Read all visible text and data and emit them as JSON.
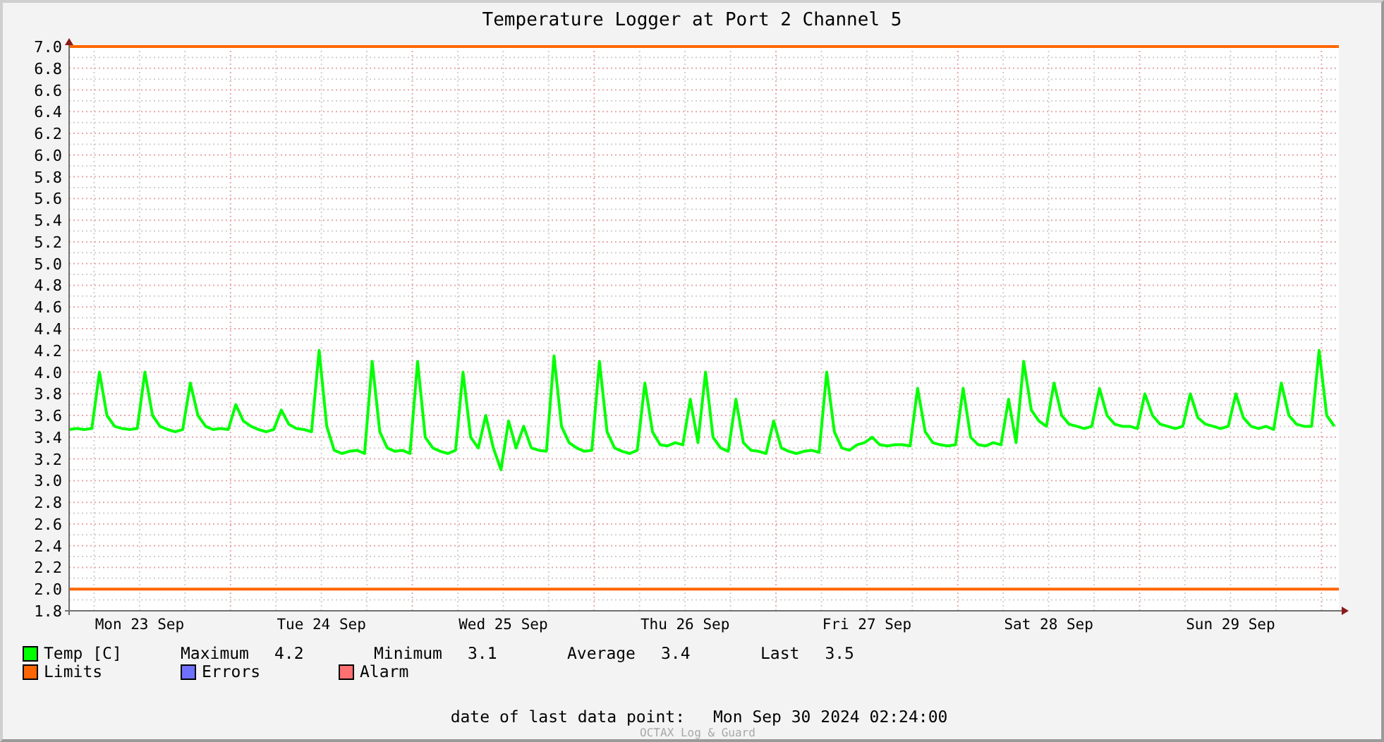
{
  "title": "Temperature Logger at Port 2 Channel 5",
  "chart_data": {
    "type": "line",
    "ylim": [
      1.8,
      7.0
    ],
    "categories": [
      null,
      null,
      null,
      null,
      null,
      null,
      null,
      null,
      null,
      "Mon 23 Sep",
      null,
      null,
      null,
      null,
      null,
      null,
      null,
      null,
      null,
      null,
      null,
      null,
      null,
      null,
      null,
      null,
      null,
      null,
      null,
      null,
      null,
      null,
      null,
      "Tue 24 Sep",
      null,
      null,
      null,
      null,
      null,
      null,
      null,
      null,
      null,
      null,
      null,
      null,
      null,
      null,
      null,
      null,
      null,
      null,
      null,
      null,
      null,
      null,
      null,
      "Wed 25 Sep",
      null,
      null,
      null,
      null,
      null,
      null,
      null,
      null,
      null,
      null,
      null,
      null,
      null,
      null,
      null,
      null,
      null,
      null,
      null,
      null,
      null,
      null,
      null,
      "Thu 26 Sep",
      null,
      null,
      null,
      null,
      null,
      null,
      null,
      null,
      null,
      null,
      null,
      null,
      null,
      null,
      null,
      null,
      null,
      null,
      null,
      null,
      null,
      null,
      null,
      "Fri 27 Sep",
      null,
      null,
      null,
      null,
      null,
      null,
      null,
      null,
      null,
      null,
      null,
      null,
      null,
      null,
      null,
      null,
      null,
      null,
      null,
      null,
      null,
      null,
      null,
      "Sat 28 Sep",
      null,
      null,
      null,
      null,
      null,
      null,
      null,
      null,
      null,
      null,
      null,
      null,
      null,
      null,
      null,
      null,
      null,
      null,
      null,
      null,
      null,
      null,
      null,
      "Sun 29 Sep",
      null,
      null,
      null,
      null,
      null,
      null,
      null,
      null,
      null,
      null,
      null,
      null,
      null,
      null
    ],
    "series": [
      {
        "name": "Temp [C]",
        "color": "#00ff00",
        "values": [
          3.47,
          3.48,
          3.47,
          3.48,
          4.0,
          3.6,
          3.5,
          3.48,
          3.47,
          3.48,
          4.0,
          3.6,
          3.5,
          3.47,
          3.45,
          3.47,
          3.9,
          3.6,
          3.5,
          3.47,
          3.48,
          3.47,
          3.7,
          3.55,
          3.5,
          3.47,
          3.45,
          3.47,
          3.65,
          3.52,
          3.48,
          3.47,
          3.45,
          4.2,
          3.5,
          3.28,
          3.25,
          3.27,
          3.28,
          3.25,
          4.1,
          3.45,
          3.3,
          3.27,
          3.28,
          3.25,
          4.1,
          3.4,
          3.3,
          3.27,
          3.25,
          3.28,
          4.0,
          3.4,
          3.3,
          3.6,
          3.3,
          3.1,
          3.55,
          3.3,
          3.5,
          3.3,
          3.28,
          3.27,
          4.15,
          3.5,
          3.35,
          3.3,
          3.27,
          3.28,
          4.1,
          3.45,
          3.3,
          3.27,
          3.25,
          3.28,
          3.9,
          3.45,
          3.33,
          3.32,
          3.35,
          3.33,
          3.75,
          3.35,
          4.0,
          3.4,
          3.3,
          3.27,
          3.75,
          3.35,
          3.28,
          3.27,
          3.25,
          3.55,
          3.3,
          3.27,
          3.25,
          3.27,
          3.28,
          3.26,
          4.0,
          3.45,
          3.3,
          3.28,
          3.33,
          3.35,
          3.4,
          3.33,
          3.32,
          3.33,
          3.33,
          3.32,
          3.85,
          3.45,
          3.35,
          3.33,
          3.32,
          3.33,
          3.85,
          3.4,
          3.33,
          3.32,
          3.35,
          3.33,
          3.75,
          3.35,
          4.1,
          3.65,
          3.55,
          3.5,
          3.9,
          3.6,
          3.52,
          3.5,
          3.48,
          3.5,
          3.85,
          3.6,
          3.52,
          3.5,
          3.5,
          3.48,
          3.8,
          3.6,
          3.52,
          3.5,
          3.48,
          3.5,
          3.8,
          3.58,
          3.52,
          3.5,
          3.48,
          3.5,
          3.8,
          3.58,
          3.5,
          3.48,
          3.5,
          3.47,
          3.9,
          3.6,
          3.52,
          3.5,
          3.5,
          4.2,
          3.6,
          3.5
        ]
      }
    ],
    "yticks": [
      {
        "value": 1.8,
        "label": "1.8"
      },
      {
        "value": 2.0,
        "label": "2.0"
      },
      {
        "value": 2.2,
        "label": "2.2"
      },
      {
        "value": 2.4,
        "label": "2.4"
      },
      {
        "value": 2.6,
        "label": "2.6"
      },
      {
        "value": 2.8,
        "label": "2.8"
      },
      {
        "value": 3.0,
        "label": "3.0"
      },
      {
        "value": 3.2,
        "label": "3.2"
      },
      {
        "value": 3.4,
        "label": "3.4"
      },
      {
        "value": 3.6,
        "label": "3.6"
      },
      {
        "value": 3.8,
        "label": "3.8"
      },
      {
        "value": 4.0,
        "label": "4.0"
      },
      {
        "value": 4.2,
        "label": "4.2"
      },
      {
        "value": 4.4,
        "label": "4.4"
      },
      {
        "value": 4.6,
        "label": "4.6"
      },
      {
        "value": 4.8,
        "label": "4.8"
      },
      {
        "value": 5.0,
        "label": "5.0"
      },
      {
        "value": 5.2,
        "label": "5.2"
      },
      {
        "value": 5.4,
        "label": "5.4"
      },
      {
        "value": 5.6,
        "label": "5.6"
      },
      {
        "value": 5.8,
        "label": "5.8"
      },
      {
        "value": 6.0,
        "label": "6.0"
      },
      {
        "value": 6.2,
        "label": "6.2"
      },
      {
        "value": 6.4,
        "label": "6.4"
      },
      {
        "value": 6.6,
        "label": "6.6"
      },
      {
        "value": 6.8,
        "label": "6.8"
      },
      {
        "value": 7.0,
        "label": "7.0"
      }
    ],
    "grid": true,
    "ref_lines": [
      {
        "axis": "y",
        "value": 7.0,
        "color": "#ff6600"
      },
      {
        "axis": "y",
        "value": 2.0,
        "color": "#ff6600"
      }
    ]
  },
  "legend_rows": [
    [
      {
        "kind": "series"
      },
      {
        "kind": "stat",
        "label": "Maximum",
        "value": "4.2"
      },
      {
        "kind": "stat",
        "label": "Minimum",
        "value": "3.1"
      },
      {
        "kind": "stat",
        "label": "Average",
        "value": "3.4"
      },
      {
        "kind": "stat",
        "label": "Last",
        "value": "3.5"
      }
    ],
    [
      {
        "kind": "swatch",
        "label": "Limits",
        "color": "#ff6600"
      },
      {
        "kind": "swatch",
        "label": "Errors",
        "color": "#7070ff"
      },
      {
        "kind": "swatch",
        "label": "Alarm",
        "color": "#ff7070"
      }
    ]
  ],
  "last_data_point": {
    "label": "date of last data point:",
    "value": "Mon Sep 30 2024 02:24:00"
  },
  "signature": "OCTAX Log & Guard"
}
